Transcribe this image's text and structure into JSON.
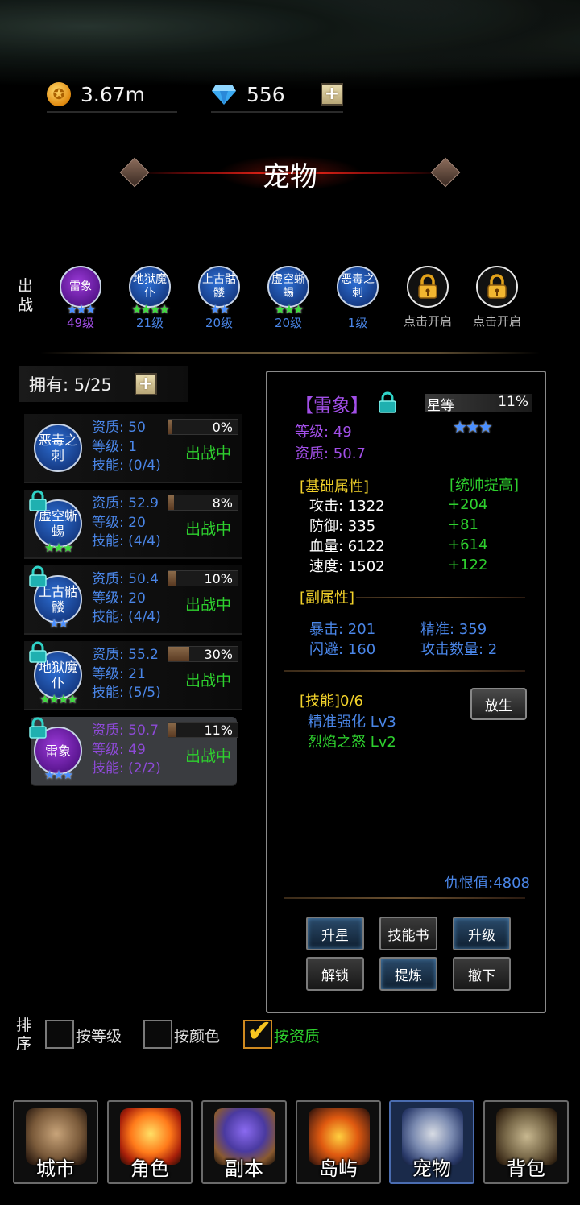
{
  "resources": {
    "gold": "3.67m",
    "diamonds": "556",
    "add_label": "+"
  },
  "title": "宠物",
  "deploy": {
    "label": "出战",
    "slots": [
      {
        "name": "雷象",
        "level": "49级",
        "stars": "★★★",
        "star_color": "blue",
        "frame": "purple",
        "level_color": "#a24fe8"
      },
      {
        "name": "地狱魔仆",
        "level": "21级",
        "stars": "★★★★",
        "star_color": "green",
        "frame": "blue",
        "level_color": "#4a86e8"
      },
      {
        "name": "上古骷髅",
        "level": "20级",
        "stars": "★★",
        "star_color": "blue",
        "frame": "blue",
        "level_color": "#4a86e8"
      },
      {
        "name": "虚空蜥蜴",
        "level": "20级",
        "stars": "★★★",
        "star_color": "green",
        "frame": "blue",
        "level_color": "#4a86e8"
      },
      {
        "name": "恶毒之刺",
        "level": "1级",
        "stars": "",
        "star_color": "blue",
        "frame": "blue",
        "level_color": "#4a86e8"
      }
    ],
    "locked": [
      {
        "caption": "点击开启"
      },
      {
        "caption": "点击开启"
      }
    ]
  },
  "owned": {
    "label": "拥有: 5/25",
    "add_label": "+"
  },
  "pets": [
    {
      "name": "恶毒之刺",
      "quality": "资质: 50",
      "level": "等级: 1",
      "skills": "技能: (0/4)",
      "pct": "0%",
      "fill": 0.0,
      "status": "出战中",
      "locked": false,
      "stars": "",
      "star_color": "blue"
    },
    {
      "name": "虚空蜥蜴",
      "quality": "资质: 52.9",
      "level": "等级: 20",
      "skills": "技能: (4/4)",
      "pct": "8%",
      "fill": 0.08,
      "status": "出战中",
      "locked": true,
      "stars": "★★★",
      "star_color": "green"
    },
    {
      "name": "上古骷髅",
      "quality": "资质: 50.4",
      "level": "等级: 20",
      "skills": "技能: (4/4)",
      "pct": "10%",
      "fill": 0.1,
      "status": "出战中",
      "locked": true,
      "stars": "★★",
      "star_color": "blue"
    },
    {
      "name": "地狱魔仆",
      "quality": "资质: 55.2",
      "level": "等级: 21",
      "skills": "技能: (5/5)",
      "pct": "30%",
      "fill": 0.3,
      "status": "出战中",
      "locked": true,
      "stars": "★★★★",
      "star_color": "green"
    },
    {
      "name": "雷象",
      "quality": "资质: 50.7",
      "level": "等级: 49",
      "skills": "技能: (2/2)",
      "pct": "11%",
      "fill": 0.11,
      "status": "出战中",
      "locked": true,
      "stars": "★★★",
      "star_color": "blue"
    }
  ],
  "detail": {
    "name": "【雷象】",
    "star_label": "星等",
    "star_pct": "11%",
    "stars": "★★★",
    "level": "等级: 49",
    "quality": "资质: 50.7",
    "base_header": "[基础属性]",
    "bonus_header": "[统帅提高]",
    "base_stats": [
      {
        "label": "攻击: 1322",
        "bonus": "+204"
      },
      {
        "label": "防御: 335",
        "bonus": "+81"
      },
      {
        "label": "血量: 6122",
        "bonus": "+614"
      },
      {
        "label": "速度: 1502",
        "bonus": "+122"
      }
    ],
    "sub_header": "[副属性]",
    "sub_stats": [
      {
        "left": "暴击: 201",
        "right": "精准: 359"
      },
      {
        "left": "闪避: 160",
        "right": "攻击数量: 2"
      }
    ],
    "skills_header": "[技能]0/6",
    "skills": [
      {
        "text": "精准强化 Lv3",
        "color": "#4a86e8"
      },
      {
        "text": "烈焰之怒 Lv2",
        "color": "#2ed02e"
      }
    ],
    "release_label": "放生",
    "hatred": "仇恨值:4808",
    "actions": [
      {
        "label": "升星",
        "style": "blue"
      },
      {
        "label": "技能书",
        "style": "gray"
      },
      {
        "label": "升级",
        "style": "blue"
      },
      {
        "label": "解锁",
        "style": "gray"
      },
      {
        "label": "提炼",
        "style": "blue"
      },
      {
        "label": "撤下",
        "style": "gray"
      }
    ]
  },
  "sort": {
    "label": "排序",
    "options": [
      {
        "label": "按等级",
        "checked": false
      },
      {
        "label": "按颜色",
        "checked": false
      },
      {
        "label": "按资质",
        "checked": true
      }
    ]
  },
  "nav": [
    {
      "label": "城市",
      "icon": "city-icon",
      "active": false
    },
    {
      "label": "角色",
      "icon": "character-icon",
      "active": false
    },
    {
      "label": "副本",
      "icon": "dungeon-icon",
      "active": false
    },
    {
      "label": "岛屿",
      "icon": "island-icon",
      "active": false
    },
    {
      "label": "宠物",
      "icon": "pet-icon",
      "active": true
    },
    {
      "label": "背包",
      "icon": "backpack-icon",
      "active": false
    }
  ]
}
